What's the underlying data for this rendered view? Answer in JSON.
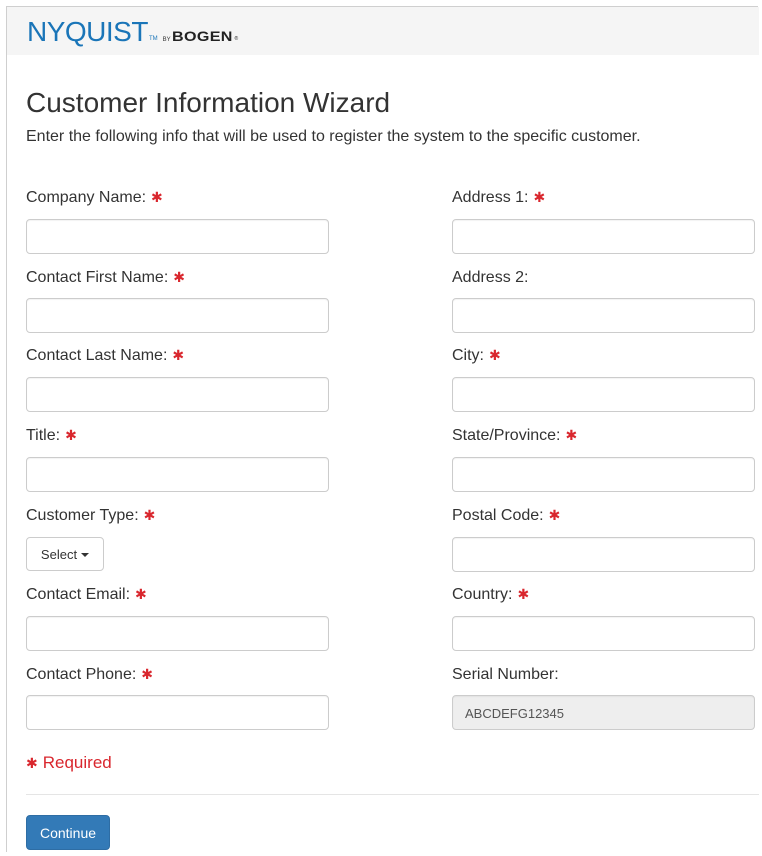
{
  "brand": {
    "name": "NYQUIST",
    "tm": "TM",
    "by": "BY",
    "partner": "BOGEN",
    "reg": "®"
  },
  "page": {
    "title": "Customer Information Wizard",
    "subtitle": "Enter the following info that will be used to register the system to the specific customer."
  },
  "required_marker": "✱",
  "form": {
    "left": [
      {
        "label": "Company Name:",
        "value": ""
      },
      {
        "label": "Contact First Name:",
        "value": ""
      },
      {
        "label": "Contact Last Name:",
        "value": ""
      },
      {
        "label": "Title:",
        "value": ""
      },
      {
        "label": "Customer Type:",
        "select_label": "Select"
      },
      {
        "label": "Contact Email:",
        "value": ""
      },
      {
        "label": "Contact Phone:",
        "value": ""
      }
    ],
    "right": [
      {
        "label": "Address 1:",
        "value": ""
      },
      {
        "label": "Address 2:",
        "value": ""
      },
      {
        "label": "City:",
        "value": ""
      },
      {
        "label": "State/Province:",
        "value": ""
      },
      {
        "label": "Postal Code:",
        "value": ""
      },
      {
        "label": "Country:",
        "value": ""
      },
      {
        "label": "Serial Number:",
        "value": "ABCDEFG12345"
      }
    ]
  },
  "required_note": "Required",
  "actions": {
    "continue_label": "Continue"
  },
  "colors": {
    "brand_blue": "#1a75b8",
    "required_red": "#d9272e",
    "primary_button": "#337ab7"
  }
}
